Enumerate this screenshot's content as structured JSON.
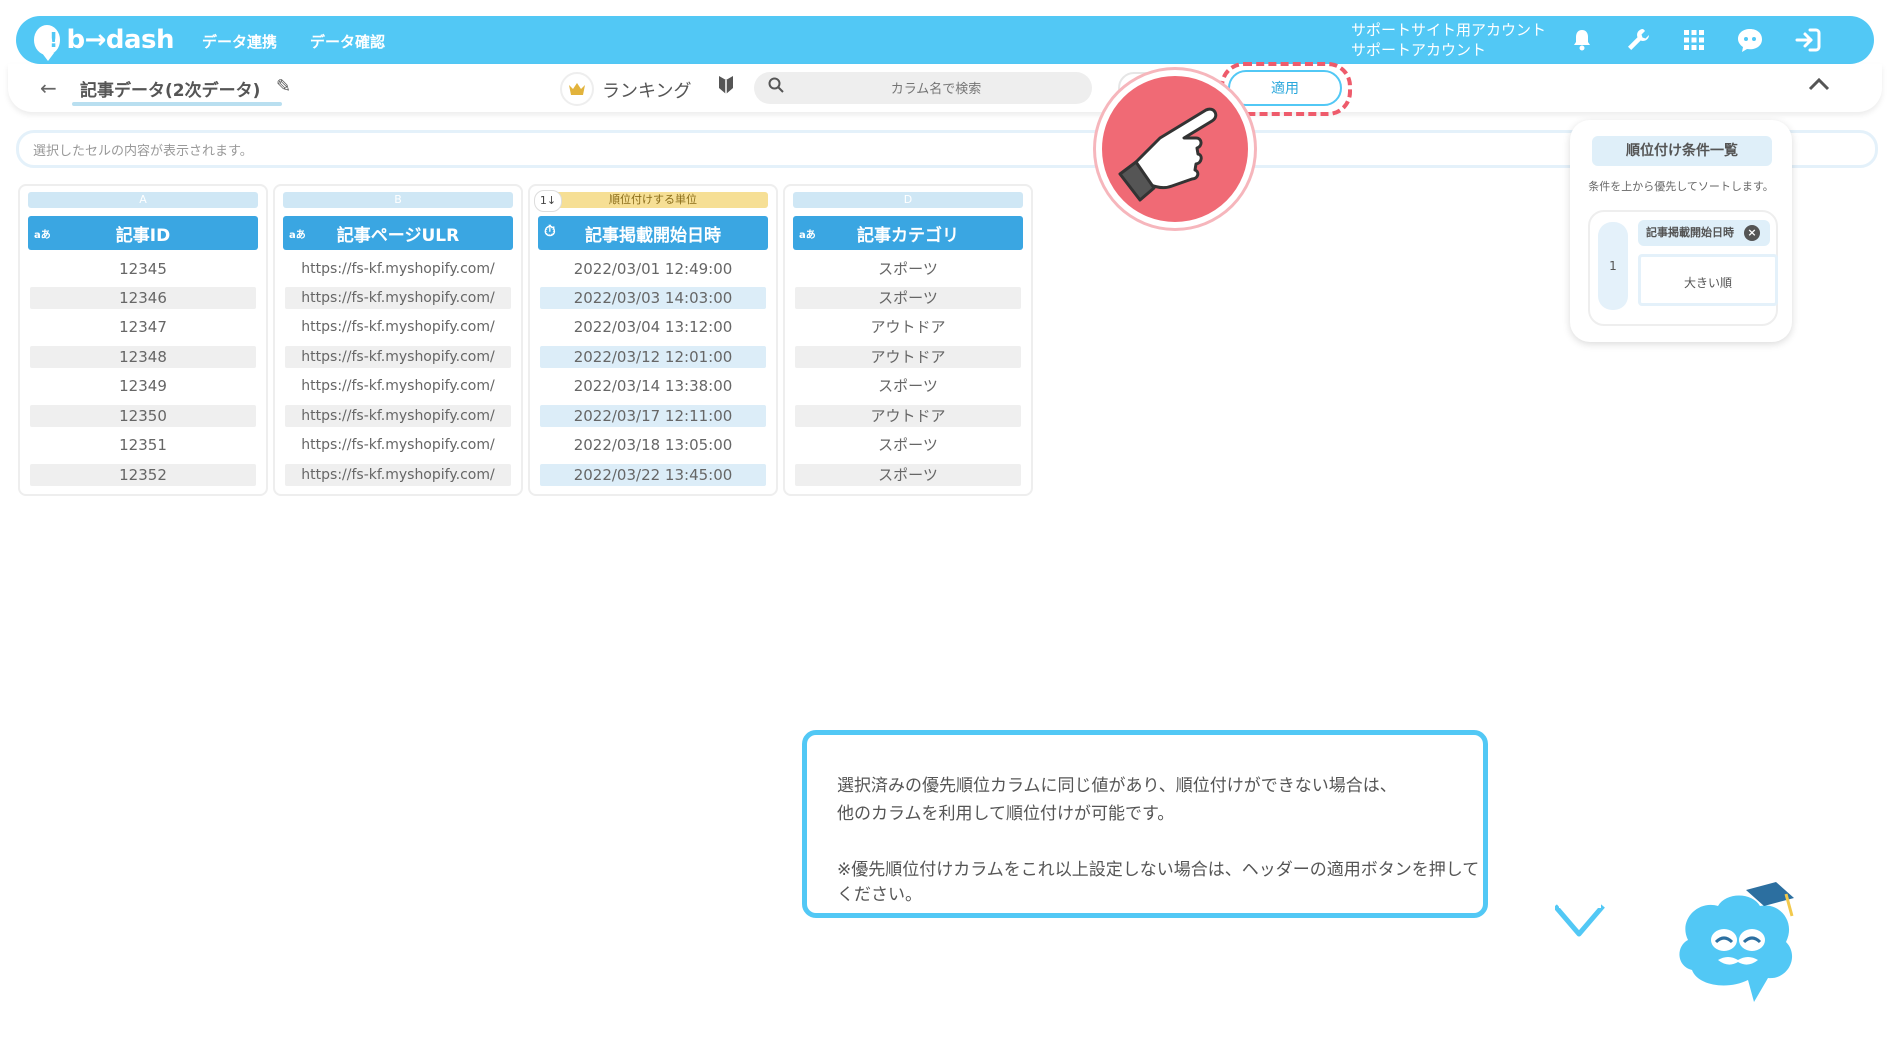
{
  "header": {
    "logo_text": "b→dash",
    "nav": [
      "データ連携",
      "データ確認"
    ],
    "account_line1": "サポートサイト用アカウント",
    "account_line2": "サポートアカウント",
    "icons": [
      "bell-icon",
      "wrench-icon",
      "apps-grid-icon",
      "chat-bot-icon",
      "logout-icon"
    ]
  },
  "toolbar": {
    "back_icon": "←",
    "title": "記事データ(2次データ)",
    "edit_icon": "✎",
    "mode_label": "ランキング",
    "search_placeholder": "カラム名で検索",
    "apply_label": "適用",
    "collapse_icon": "︿"
  },
  "cell_bar": {
    "placeholder": "選択したセルの内容が表示されます。"
  },
  "table": {
    "columns": [
      {
        "letter": "A",
        "type": "aあ",
        "title": "記事ID",
        "values": [
          "12345",
          "12346",
          "12347",
          "12348",
          "12349",
          "12350",
          "12351",
          "12352"
        ]
      },
      {
        "letter": "B",
        "type": "aあ",
        "title": "記事ページULR",
        "values": [
          "https://fs-kf.myshopify.com/",
          "https://fs-kf.myshopify.com/",
          "https://fs-kf.myshopify.com/",
          "https://fs-kf.myshopify.com/",
          "https://fs-kf.myshopify.com/",
          "https://fs-kf.myshopify.com/",
          "https://fs-kf.myshopify.com/",
          "https://fs-kf.myshopify.com/"
        ]
      },
      {
        "letter": "順位付けする単位",
        "sort_badge": "1↓",
        "type": "⏱",
        "title": "記事掲載開始日時",
        "values": [
          "2022/03/01 12:49:00",
          "2022/03/03 14:03:00",
          "2022/03/04 13:12:00",
          "2022/03/12 12:01:00",
          "2022/03/14 13:38:00",
          "2022/03/17 12:11:00",
          "2022/03/18 13:05:00",
          "2022/03/22 13:45:00"
        ]
      },
      {
        "letter": "D",
        "type": "aあ",
        "title": "記事カテゴリ",
        "values": [
          "スポーツ",
          "スポーツ",
          "アウトドア",
          "アウトドア",
          "スポーツ",
          "アウトドア",
          "スポーツ",
          "スポーツ"
        ]
      }
    ]
  },
  "ranking_panel": {
    "title": "順位付け条件一覧",
    "subtitle": "条件を上から優先してソートします。",
    "conditions": [
      {
        "rank": "1",
        "column": "記事掲載開始日時",
        "order": "大きい順"
      }
    ]
  },
  "message": {
    "line1": "選択済みの優先順位カラムに同じ値があり、順位付けができない場合は、",
    "line2": "他のカラムを利用して順位付けが可能です。",
    "line3": "※優先順位付けカラムをこれ以上設定しない場合は、ヘッダーの適用ボタンを押してください。"
  }
}
